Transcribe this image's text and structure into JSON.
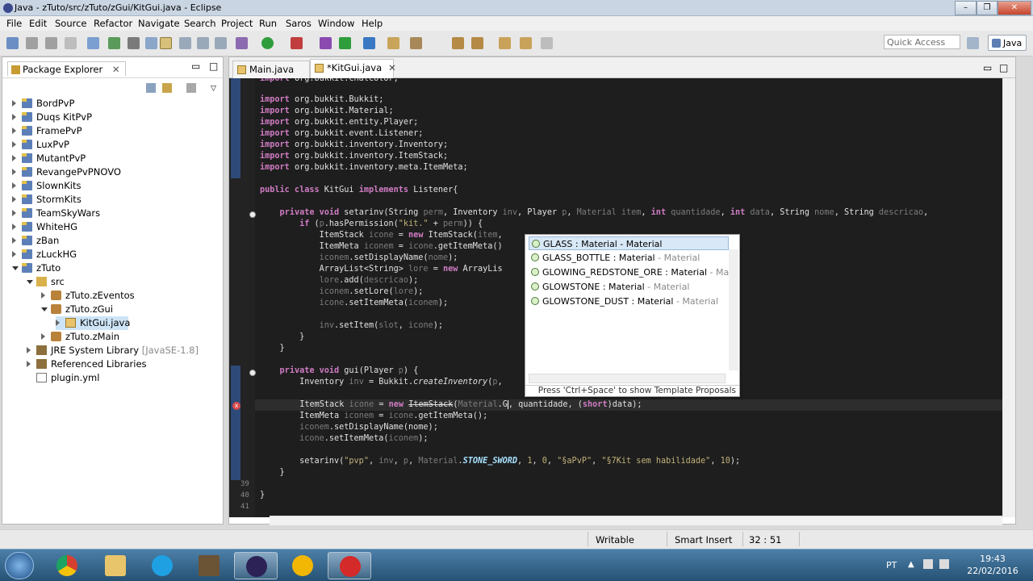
{
  "window": {
    "title": "Java - zTuto/src/zTuto/zGui/KitGui.java - Eclipse"
  },
  "menu": [
    "File",
    "Edit",
    "Source",
    "Refactor",
    "Navigate",
    "Search",
    "Project",
    "Run",
    "Saros",
    "Window",
    "Help"
  ],
  "toolbar": {
    "quick_access_placeholder": "Quick Access",
    "perspective": "Java"
  },
  "package_explorer": {
    "title": "Package Explorer",
    "items": [
      {
        "label": "BordPvP",
        "type": "project"
      },
      {
        "label": "Duqs KitPvP",
        "type": "project"
      },
      {
        "label": "FramePvP",
        "type": "project"
      },
      {
        "label": "LuxPvP",
        "type": "project"
      },
      {
        "label": "MutantPvP",
        "type": "project"
      },
      {
        "label": "RevangePvPNOVO",
        "type": "project"
      },
      {
        "label": "SlownKits",
        "type": "project"
      },
      {
        "label": "StormKits",
        "type": "project"
      },
      {
        "label": "TeamSkyWars",
        "type": "project"
      },
      {
        "label": "WhiteHG",
        "type": "project"
      },
      {
        "label": "zBan",
        "type": "project"
      },
      {
        "label": "zLuckHG",
        "type": "project"
      },
      {
        "label": "zTuto",
        "type": "project"
      },
      {
        "label": "src",
        "type": "srcfolder"
      },
      {
        "label": "zTuto.zEventos",
        "type": "package"
      },
      {
        "label": "zTuto.zGui",
        "type": "package"
      },
      {
        "label": "KitGui.java",
        "type": "javafile"
      },
      {
        "label": "zTuto.zMain",
        "type": "package"
      },
      {
        "label": "JRE System Library",
        "suffix": "[JavaSE-1.8]",
        "type": "library"
      },
      {
        "label": "Referenced Libraries",
        "type": "library"
      },
      {
        "label": "plugin.yml",
        "type": "file"
      }
    ]
  },
  "editor": {
    "tabs": [
      {
        "label": "Main.java",
        "active": false
      },
      {
        "label": "*KitGui.java",
        "active": true
      }
    ],
    "line_numbers": [
      "39",
      "40",
      "41"
    ]
  },
  "content_assist": {
    "items": [
      {
        "name": "GLASS : Material",
        "type": "- Material"
      },
      {
        "name": "GLASS_BOTTLE : Material",
        "type": "- Material"
      },
      {
        "name": "GLOWING_REDSTONE_ORE : Material",
        "type": "- Materi"
      },
      {
        "name": "GLOWSTONE : Material",
        "type": "- Material"
      },
      {
        "name": "GLOWSTONE_DUST : Material",
        "type": "- Material"
      }
    ],
    "footer": "Press 'Ctrl+Space' to show Template Proposals"
  },
  "status": {
    "writable": "Writable",
    "insert_mode": "Smart Insert",
    "position": "32 : 51"
  },
  "taskbar": {
    "lang": "PT",
    "time": "19:43",
    "date": "22/02/2016"
  },
  "colors": {
    "editor_bg": "#1e1e1e",
    "keyword": "#d07cc4",
    "string": "#c2b27a",
    "taskbar": "#265274"
  }
}
